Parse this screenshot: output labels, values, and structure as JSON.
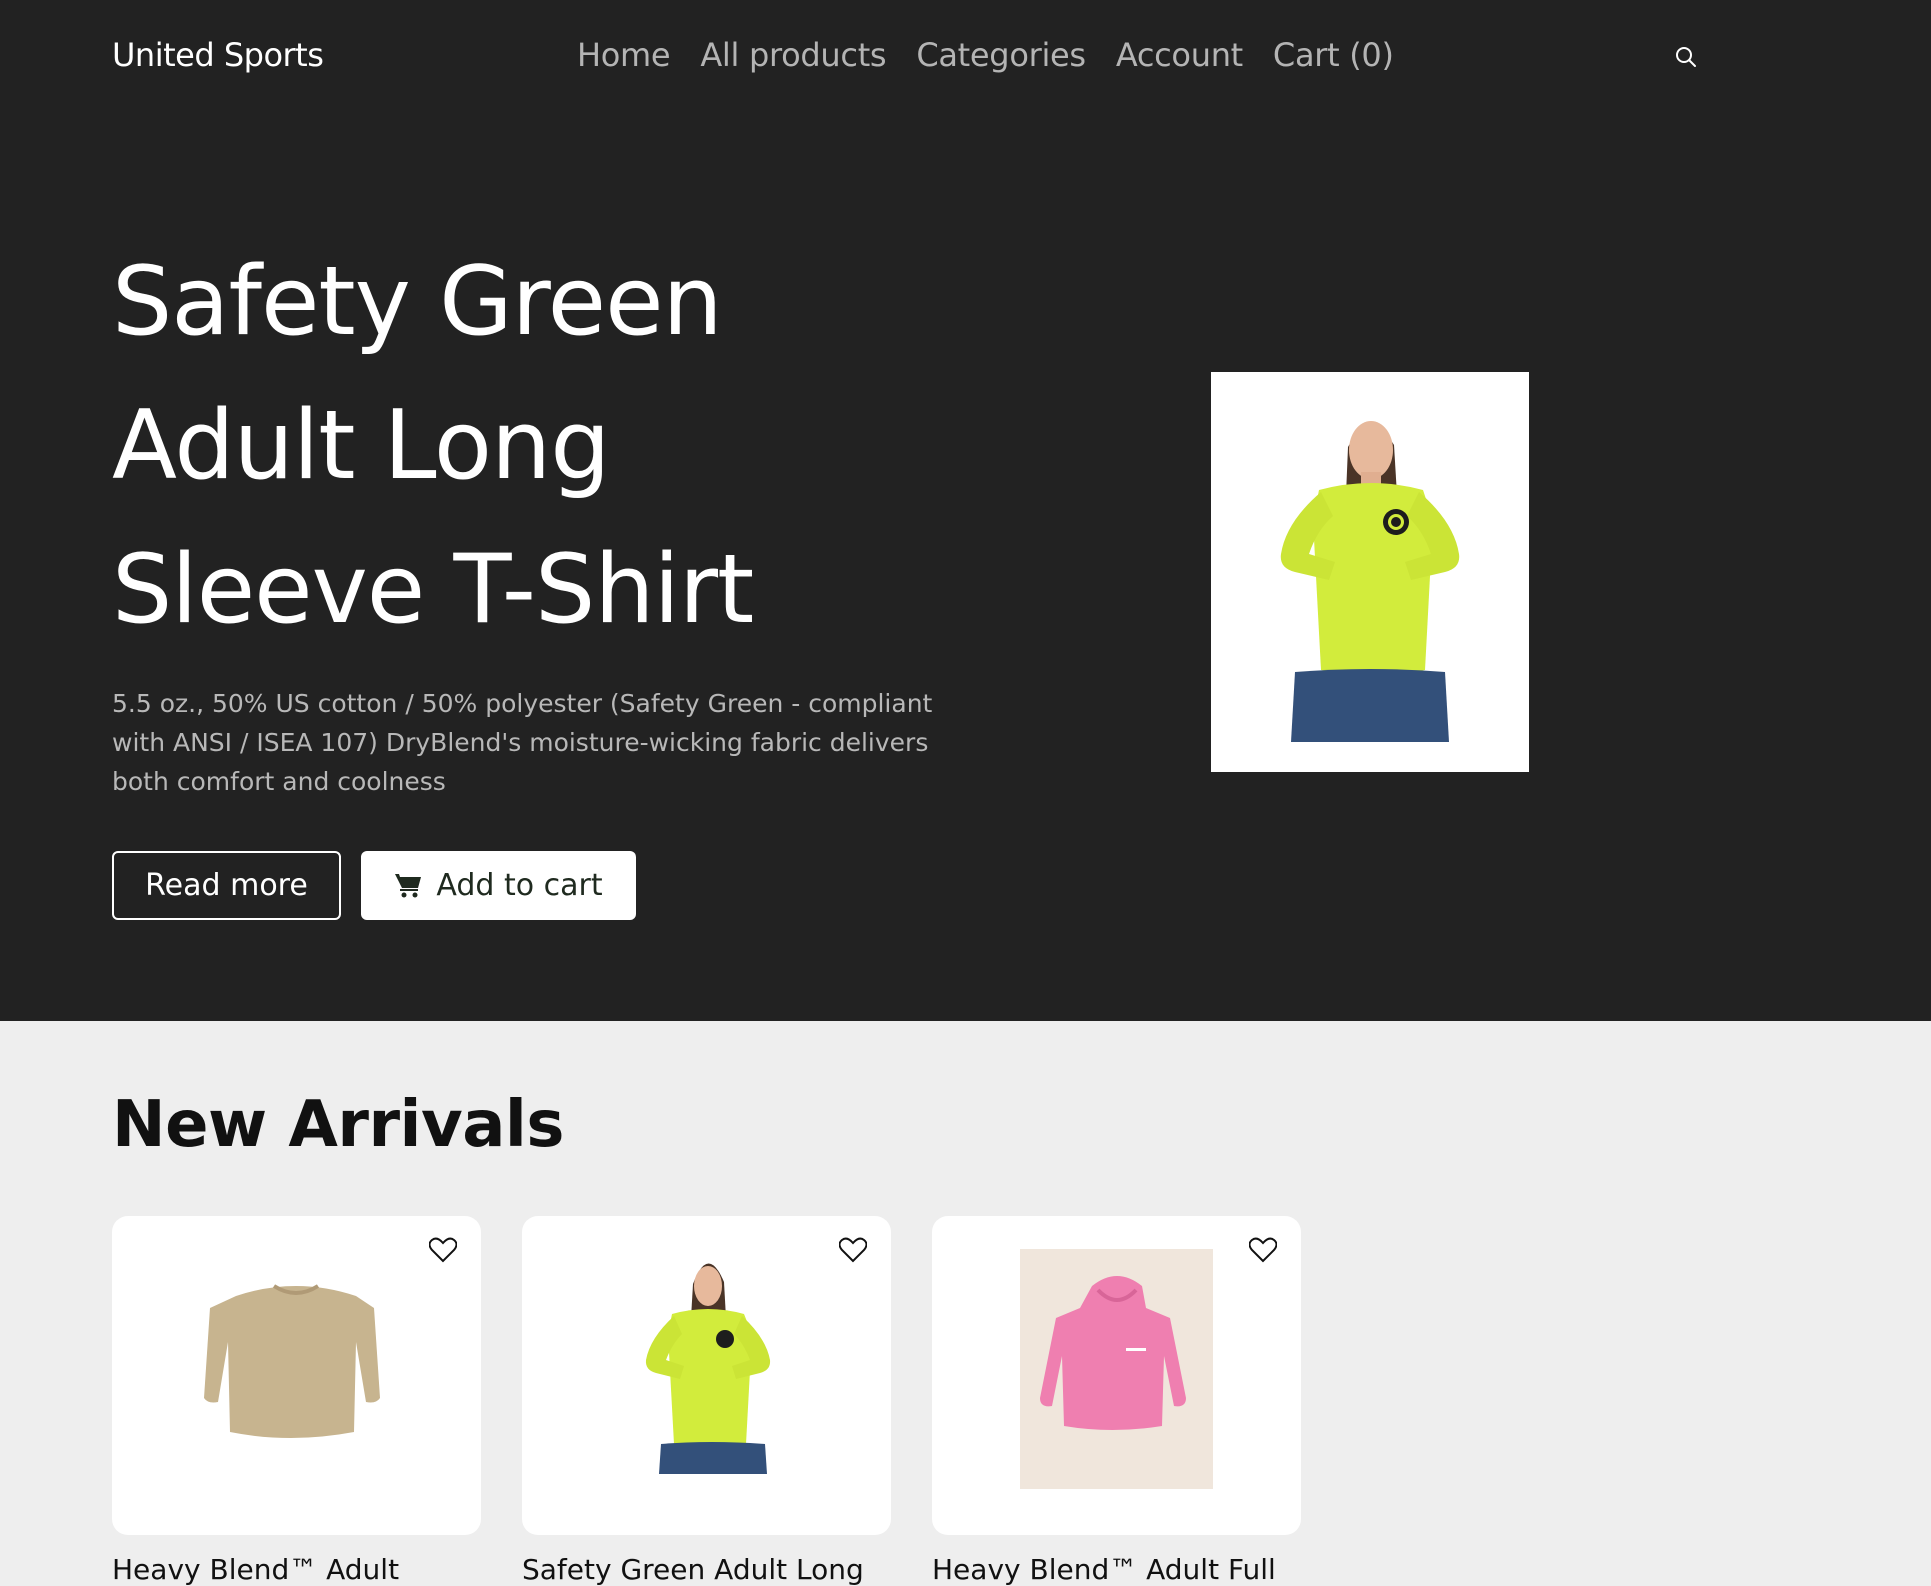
{
  "header": {
    "brand": "United Sports",
    "nav": [
      "Home",
      "All products",
      "Categories",
      "Account",
      "Cart (0)"
    ],
    "search_icon": "search-icon"
  },
  "hero": {
    "title_lines": [
      "Safety Green",
      "Adult Long",
      "Sleeve T-Shirt"
    ],
    "description": "5.5 oz., 50% US cotton / 50% polyester (Safety Green - compliant with ANSI / ISEA 107) DryBlend's moisture-wicking fabric delivers both comfort and coolness",
    "read_more_label": "Read more",
    "add_to_cart_label": "Add to cart",
    "cart_icon": "cart-icon",
    "image_alt": "Woman wearing safety green long sleeve t-shirt"
  },
  "new_arrivals": {
    "title": "New Arrivals",
    "products": [
      {
        "title": "Heavy Blend™ Adult",
        "color": "#c7b48f",
        "image": "tan crewneck sweatshirt",
        "favorite_icon": "heart-icon"
      },
      {
        "title": "Safety Green Adult Long",
        "color": "#d2ec3c",
        "image": "safety green long sleeve t-shirt",
        "favorite_icon": "heart-icon"
      },
      {
        "title": "Heavy Blend™ Adult Full",
        "color": "#ef7fb0",
        "image": "pink hooded sweatshirt",
        "favorite_icon": "heart-icon"
      }
    ]
  },
  "colors": {
    "hero_bg": "#222222",
    "page_bg": "#eeeeee",
    "nav_text": "#b4b4b4",
    "white": "#ffffff"
  }
}
